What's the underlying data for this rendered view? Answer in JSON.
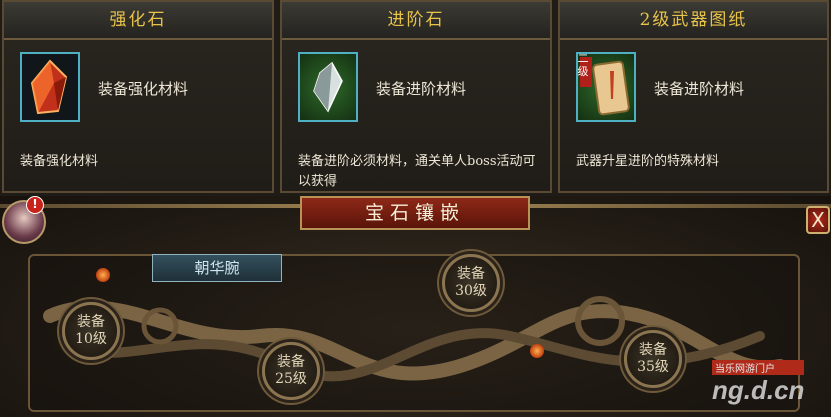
{
  "cards": [
    {
      "title": "强化石",
      "subtitle": "装备强化材料",
      "description": "装备强化材料",
      "icon": "red-crystal-icon"
    },
    {
      "title": "进阶石",
      "subtitle": "装备进阶材料",
      "description": "装备进阶必须材料，通关单人boss活动可以获得",
      "icon": "silver-crystal-icon"
    },
    {
      "title": "2级武器图纸",
      "subtitle": "装备进阶材料",
      "description": "武器升星进阶的特殊材料",
      "icon": "scroll-blueprint-icon",
      "badge": "二级"
    }
  ],
  "panel": {
    "banner": "宝石镶嵌",
    "tab": "朝华腕",
    "slots": [
      {
        "line1": "装备",
        "line2": "10级"
      },
      {
        "line1": "装备",
        "line2": "25级"
      },
      {
        "line1": "装备",
        "line2": "30级"
      },
      {
        "line1": "装备",
        "line2": "35级"
      }
    ],
    "alert": "!",
    "close": "X"
  },
  "watermark": {
    "line1": "当乐网游门户",
    "line2": "ng.d.cn"
  }
}
